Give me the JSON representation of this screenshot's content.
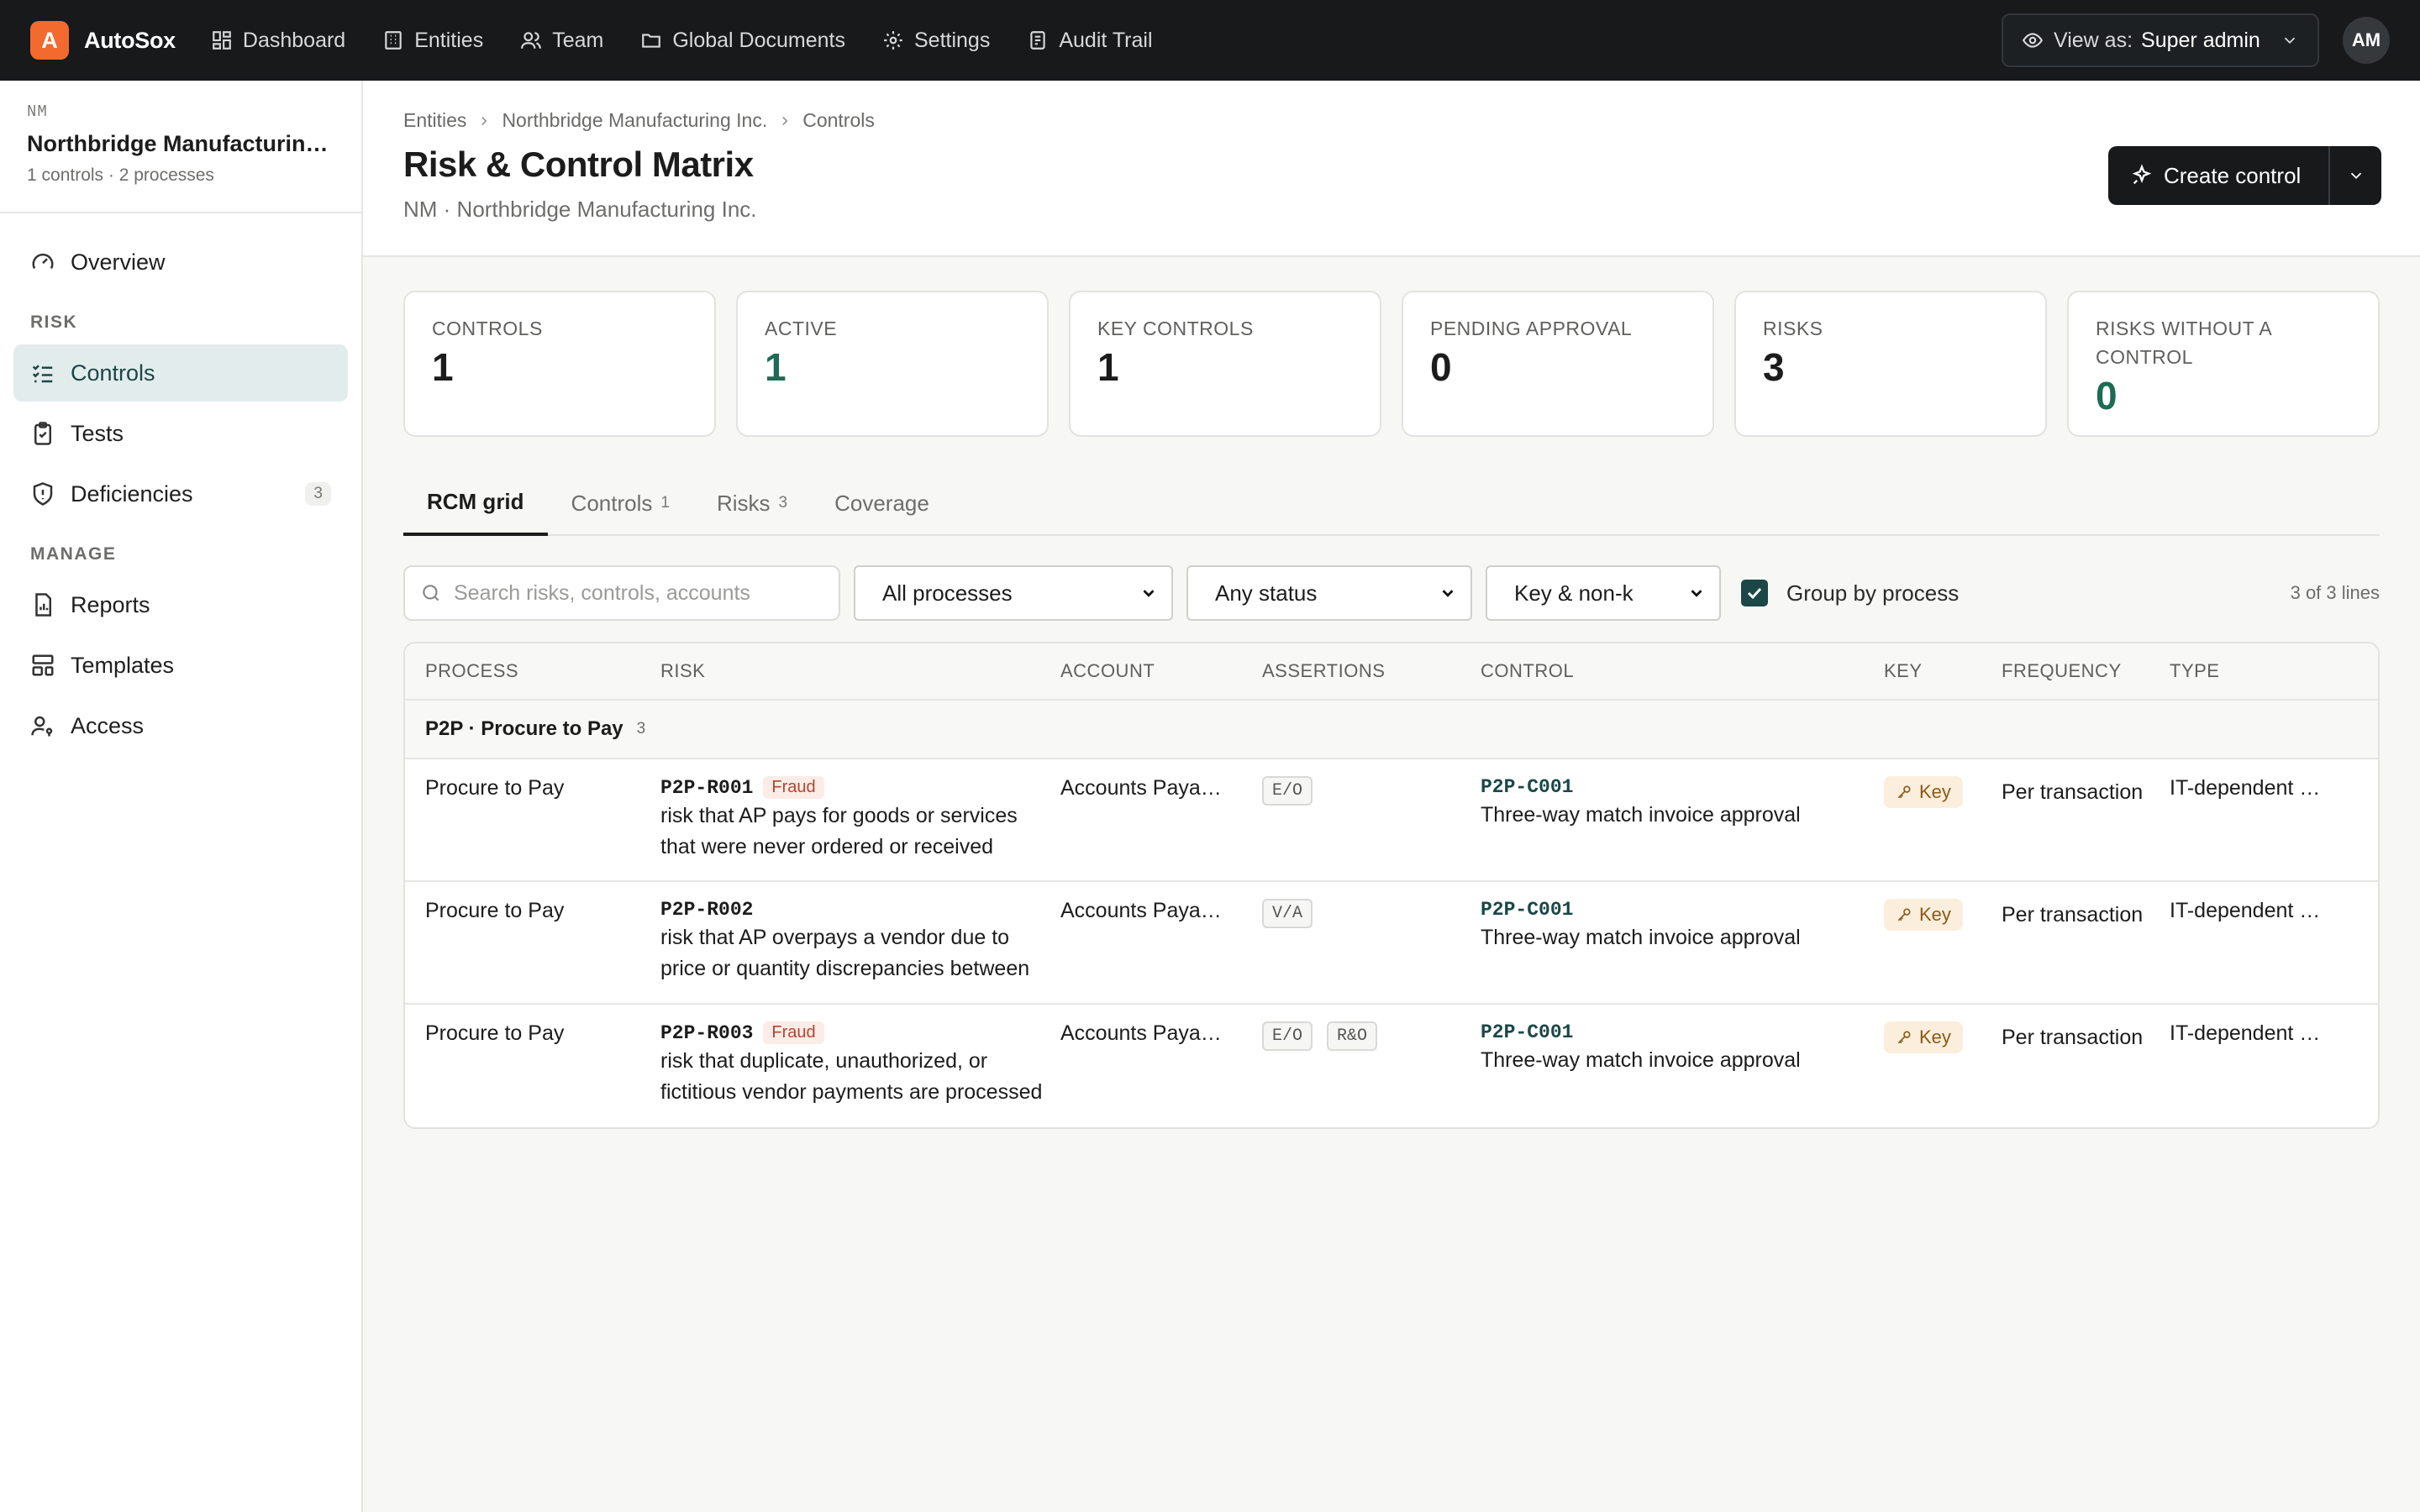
{
  "app": {
    "logo_letter": "A",
    "name": "AutoSox",
    "nav": [
      {
        "label": "Dashboard",
        "icon": "dashboard-icon"
      },
      {
        "label": "Entities",
        "icon": "building-icon"
      },
      {
        "label": "Team",
        "icon": "users-icon"
      },
      {
        "label": "Global Documents",
        "icon": "folder-icon"
      },
      {
        "label": "Settings",
        "icon": "gear-icon"
      },
      {
        "label": "Audit Trail",
        "icon": "audit-icon"
      }
    ],
    "view_as_label": "View as:",
    "view_as_value": "Super admin",
    "avatar_initials": "AM"
  },
  "entity": {
    "code": "NM",
    "name": "Northbridge Manufacturing Inc.",
    "meta": "1 controls · 2 processes"
  },
  "sidebar": {
    "overview": "Overview",
    "risk_section": "RISK",
    "risk_items": [
      {
        "label": "Controls",
        "active": true
      },
      {
        "label": "Tests"
      },
      {
        "label": "Deficiencies",
        "count": "3"
      }
    ],
    "manage_section": "MANAGE",
    "manage_items": [
      {
        "label": "Reports"
      },
      {
        "label": "Templates"
      },
      {
        "label": "Access"
      }
    ]
  },
  "header": {
    "breadcrumbs": [
      "Entities",
      "Northbridge Manufacturing Inc.",
      "Controls"
    ],
    "title": "Risk & Control Matrix",
    "subtitle": "NM · Northbridge Manufacturing Inc.",
    "create_label": "Create control"
  },
  "stats": [
    {
      "label": "CONTROLS",
      "value": "1"
    },
    {
      "label": "ACTIVE",
      "value": "1",
      "color": "#1f6b55"
    },
    {
      "label": "KEY CONTROLS",
      "value": "1"
    },
    {
      "label": "PENDING APPROVAL",
      "value": "0"
    },
    {
      "label": "RISKS",
      "value": "3"
    },
    {
      "label": "RISKS WITHOUT A CONTROL",
      "value": "0",
      "color": "#1f6b55"
    }
  ],
  "tabs": [
    {
      "label": "RCM grid",
      "active": true
    },
    {
      "label": "Controls",
      "count": "1"
    },
    {
      "label": "Risks",
      "count": "3"
    },
    {
      "label": "Coverage"
    }
  ],
  "filters": {
    "search_placeholder": "Search risks, controls, accounts",
    "process": "All processes",
    "status": "Any status",
    "key": "Key & non-k",
    "group_by_label": "Group by process",
    "group_by_checked": true,
    "lines": "3 of 3 lines"
  },
  "table": {
    "columns": [
      "PROCESS",
      "RISK",
      "ACCOUNT",
      "ASSERTIONS",
      "CONTROL",
      "KEY",
      "FREQUENCY",
      "TYPE"
    ],
    "group": {
      "label": "P2P · Procure to Pay",
      "count": "3"
    },
    "rows": [
      {
        "process": "Procure to Pay",
        "risk_id": "P2P-R001",
        "fraud": "Fraud",
        "risk_text": "risk that AP pays for goods or services that were never ordered or received",
        "account": "Accounts Payable",
        "assertions": [
          "E/O"
        ],
        "control_id": "P2P-C001",
        "control_name": "Three-way match invoice approval",
        "key": "Key",
        "frequency": "Per transaction",
        "type": "IT-dependent manual"
      },
      {
        "process": "Procure to Pay",
        "risk_id": "P2P-R002",
        "fraud": "",
        "risk_text": "risk that AP overpays a vendor due to price or quantity discrepancies between PO, receipt, and invoice",
        "account": "Accounts Payable",
        "assertions": [
          "V/A"
        ],
        "control_id": "P2P-C001",
        "control_name": "Three-way match invoice approval",
        "key": "Key",
        "frequency": "Per transaction",
        "type": "IT-dependent manual"
      },
      {
        "process": "Procure to Pay",
        "risk_id": "P2P-R003",
        "fraud": "Fraud",
        "risk_text": "risk that duplicate, unauthorized, or fictitious vendor payments are processed",
        "account": "Accounts Payable",
        "assertions": [
          "E/O",
          "R&O"
        ],
        "control_id": "P2P-C001",
        "control_name": "Three-way match invoice approval",
        "key": "Key",
        "frequency": "Per transaction",
        "type": "IT-dependent manual"
      }
    ]
  },
  "colors": {
    "accent": "#1b4747",
    "brand": "#f26a2e",
    "positive": "#1f6b55",
    "fraud": "#b2452f",
    "key_badge": "#fbeedc"
  }
}
